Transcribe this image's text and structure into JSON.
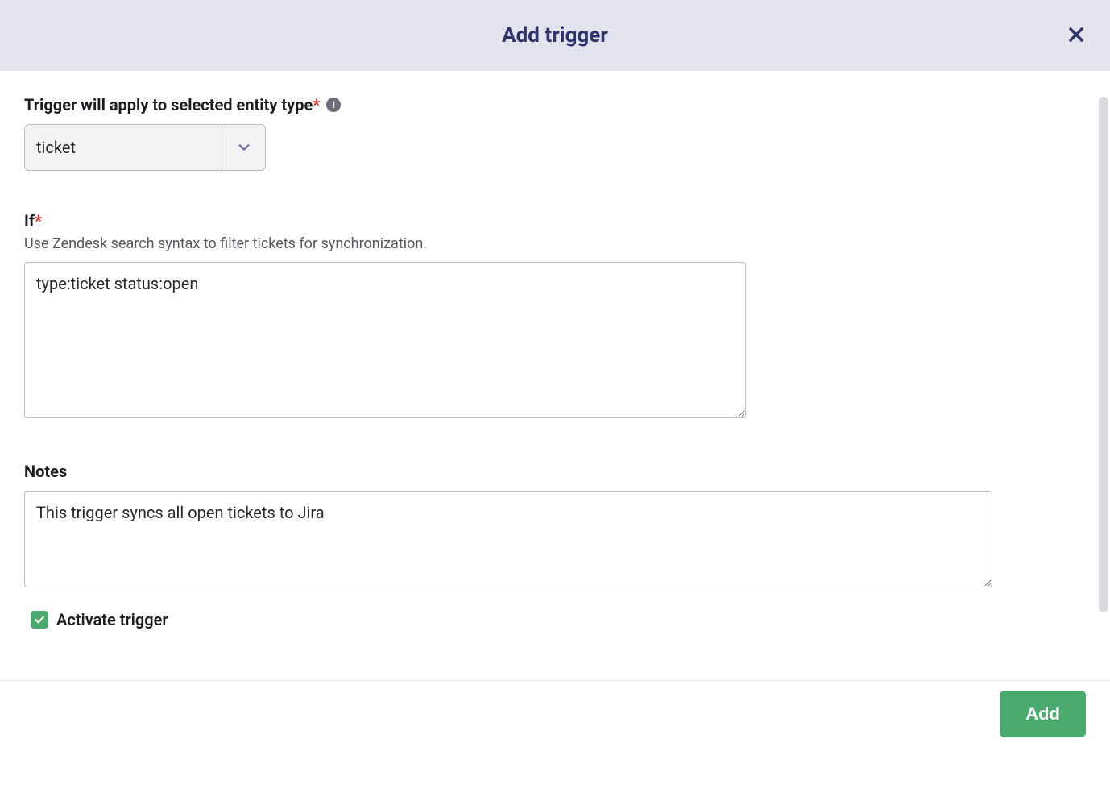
{
  "dialog": {
    "title": "Add trigger"
  },
  "fields": {
    "entity": {
      "label": "Trigger will apply to selected entity type",
      "value": "ticket"
    },
    "if": {
      "label": "If",
      "help": "Use Zendesk search syntax to filter tickets for synchronization.",
      "value": "type:ticket status:open"
    },
    "notes": {
      "label": "Notes",
      "value": "This trigger syncs all open tickets to Jira"
    },
    "activate": {
      "label": "Activate trigger",
      "checked": true
    }
  },
  "actions": {
    "add": "Add"
  }
}
